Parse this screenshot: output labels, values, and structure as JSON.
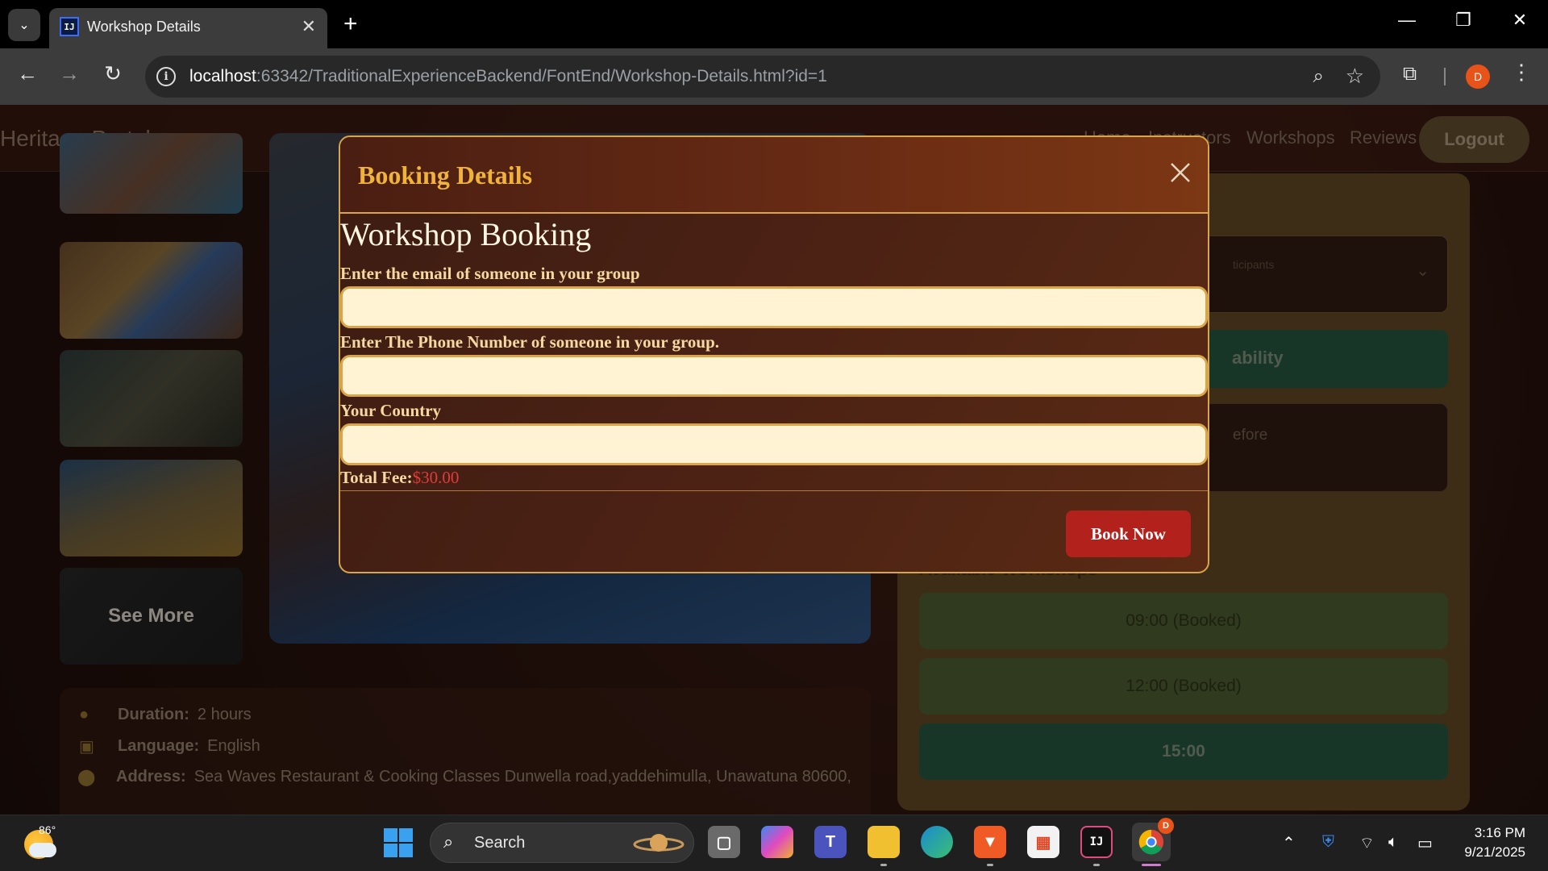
{
  "browser": {
    "tab_title": "Workshop Details",
    "url_host": "localhost",
    "url_path": ":63342/TraditionalExperienceBackend/FontEnd/Workshop-Details.html?id=1",
    "profile_initial": "D"
  },
  "site": {
    "brand": "Heritage Portal",
    "nav": [
      "Home",
      "Instructors",
      "Workshops",
      "Reviews"
    ],
    "logout_label": "Logout"
  },
  "gallery": {
    "see_more_label": "See More"
  },
  "details": {
    "duration_key": "Duration:",
    "duration_value": "2 hours",
    "language_key": "Language:",
    "language_value": "English",
    "address_key": "Address:",
    "address_value": "Sea Waves Restaurant & Cooking Classes Dunwella road,yaddehimulla, Unawatuna 80600,"
  },
  "side_panel": {
    "select_placeholder_fragment": "ticipants",
    "check_label_fragment": "ability",
    "note_fragment": "efore",
    "heading": "Available Workshops",
    "slots": [
      {
        "label": "09:00 (Booked)",
        "booked": true
      },
      {
        "label": "12:00 (Booked)",
        "booked": true
      },
      {
        "label": "15:00",
        "booked": false
      }
    ]
  },
  "modal": {
    "title": "Booking Details",
    "heading": "Workshop Booking",
    "email_label": "Enter the email of someone in your group",
    "phone_label": "Enter The Phone Number of someone in your group.",
    "country_label": "Your Country",
    "email_value": "",
    "phone_value": "",
    "country_value": "",
    "fee_label": "Total Fee:",
    "fee_value": "$30.00",
    "book_label": "Book Now"
  },
  "taskbar": {
    "temperature": "86°",
    "search_label": "Search",
    "time": "3:16 PM",
    "date": "9/21/2025",
    "chrome_badge": "D"
  },
  "colors": {
    "modal_accent": "#d8a54a",
    "modal_title": "#f0b33a",
    "fee_value": "#e33a3a",
    "book_button": "#b3211c"
  }
}
